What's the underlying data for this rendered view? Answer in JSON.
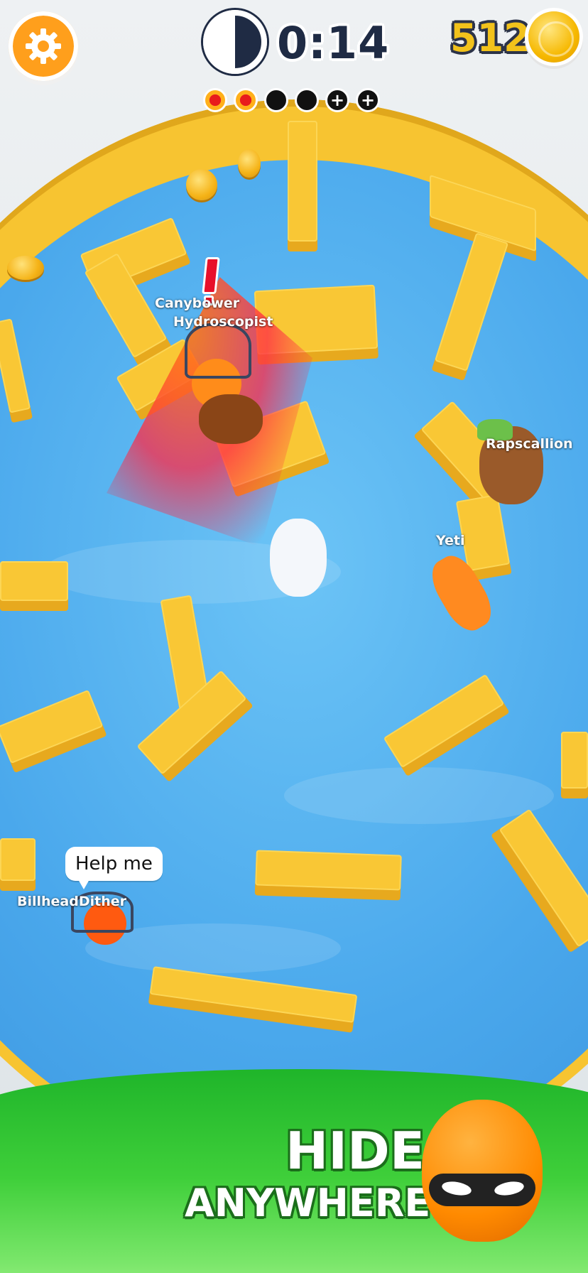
{
  "hud": {
    "timer": "0:14",
    "coins": "512",
    "progress_dots": [
      "red",
      "red",
      "black",
      "black",
      "plus",
      "plus"
    ],
    "plus_symbol": "+"
  },
  "players": {
    "seeker_name": "Canybower",
    "player2": "Hydroscopist",
    "player3": "Rapscallion",
    "player4": "Yeti",
    "player5": "BillheadDither"
  },
  "chat": {
    "bubble": "Help me"
  },
  "banner": {
    "line1": "HIDE",
    "line2": "ANYWHERE!"
  },
  "colors": {
    "settings": "#ff9f1c",
    "walls": "#f9c735",
    "water": "#4aa8ec",
    "banner": "#3fcf3a"
  },
  "icons": [
    "gear-icon",
    "timer-icon",
    "coin-icon"
  ]
}
